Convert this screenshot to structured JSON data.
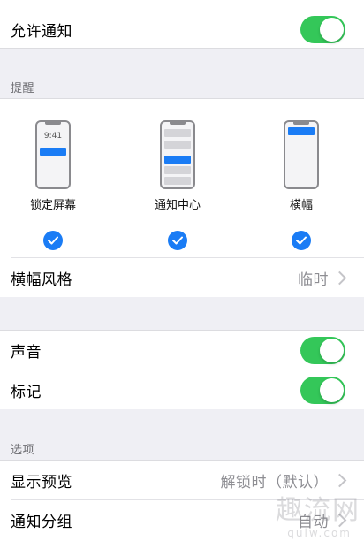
{
  "allow_notifications": {
    "label": "允许通知",
    "enabled": true
  },
  "alerts": {
    "header": "提醒",
    "previews": [
      {
        "label": "锁定屏幕",
        "time": "9:41",
        "checked": true
      },
      {
        "label": "通知中心",
        "checked": true
      },
      {
        "label": "横幅",
        "checked": true
      }
    ],
    "banner_style": {
      "label": "横幅风格",
      "value": "临时"
    }
  },
  "sounds": {
    "label": "声音",
    "enabled": true
  },
  "badges": {
    "label": "标记",
    "enabled": true
  },
  "options": {
    "header": "选项",
    "show_previews": {
      "label": "显示预览",
      "value": "解锁时（默认）"
    },
    "grouping": {
      "label": "通知分组",
      "value": "自动"
    }
  },
  "watermark": {
    "text": "趣流网",
    "sub": "qulw.com"
  },
  "colors": {
    "toggle_on": "#34c759",
    "accent": "#1a7cf5",
    "background": "#efeff4"
  }
}
